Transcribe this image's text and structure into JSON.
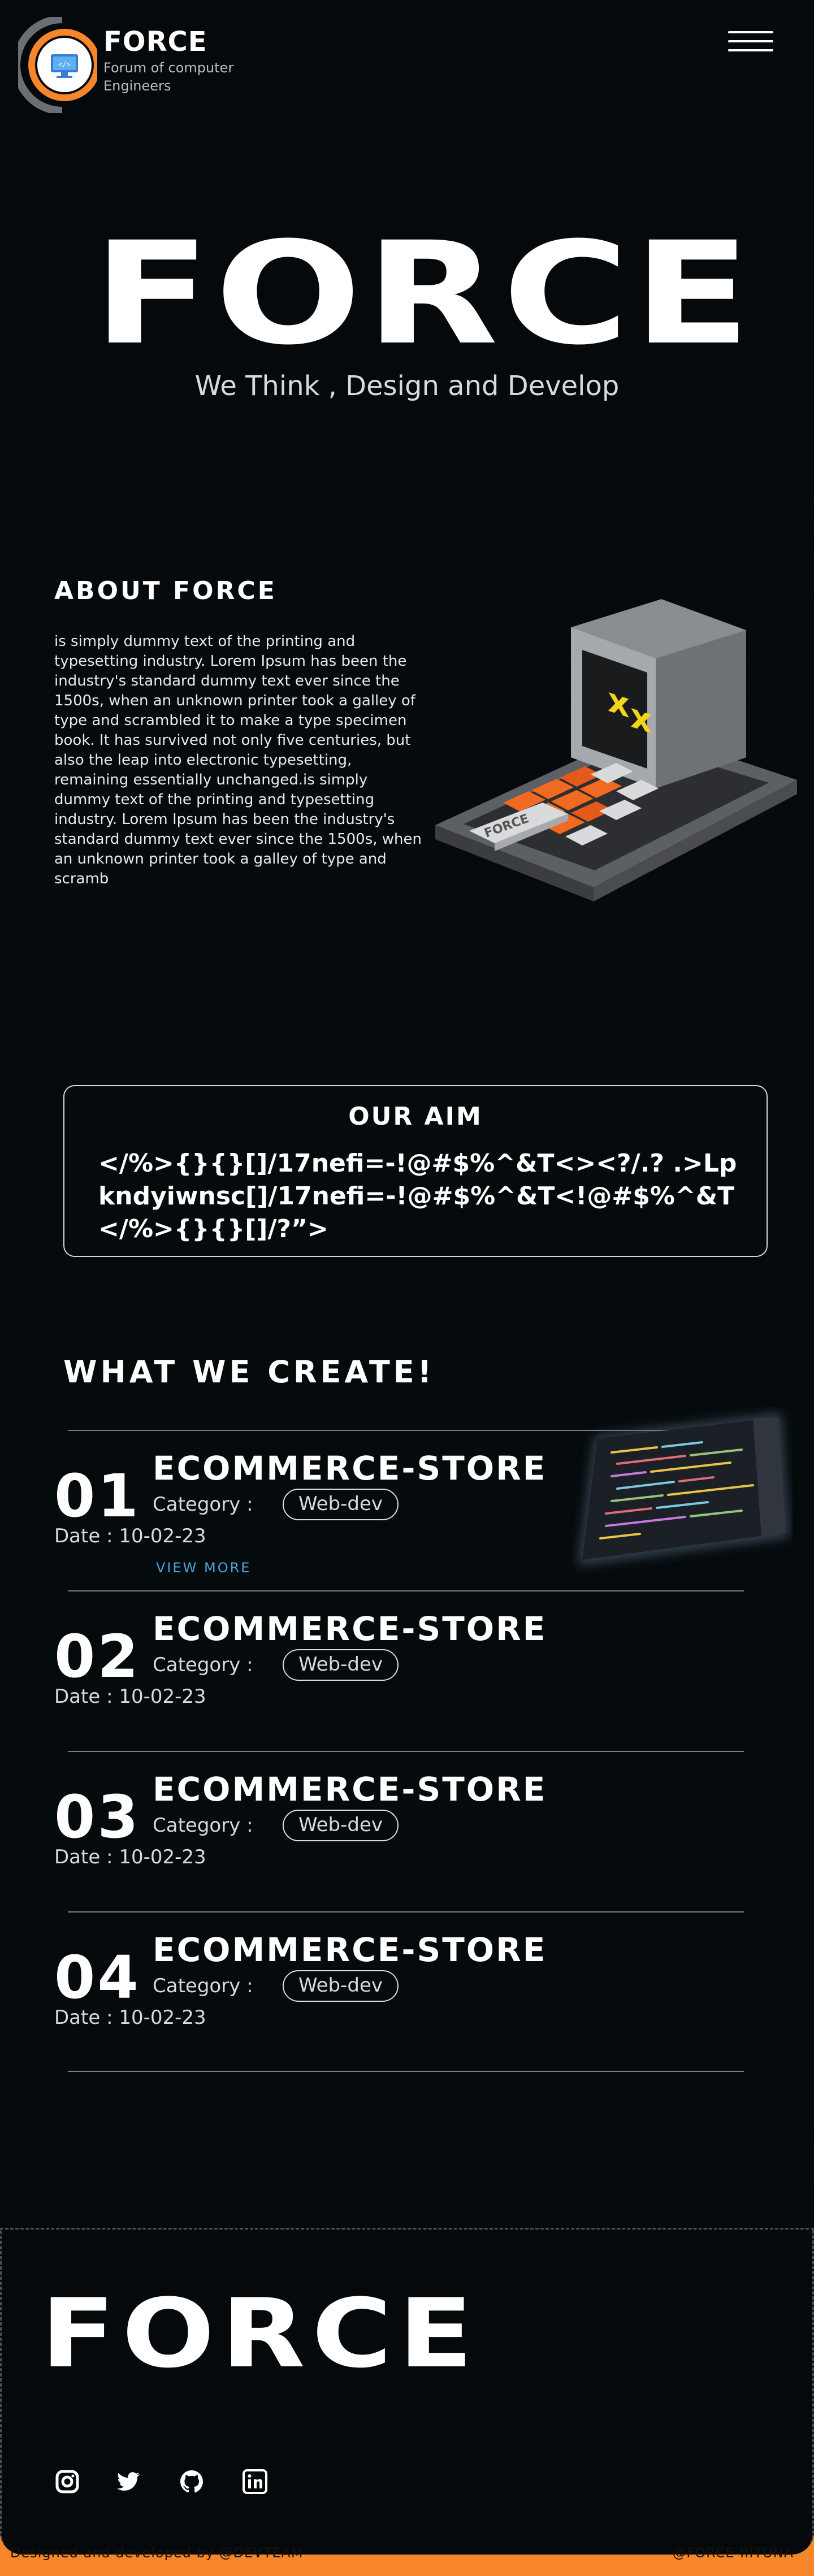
{
  "header": {
    "brand_name": "FORCE",
    "brand_subtitle": "Forum of computer Engineers",
    "logo_icon": "monitor-code-icon",
    "menu_icon": "hamburger-menu-icon"
  },
  "hero": {
    "title": "FORCE",
    "tagline": "We Think , Design and Develop"
  },
  "about": {
    "heading": "ABOUT FORCE",
    "text": "is simply dummy text of the printing and typesetting industry. Lorem Ipsum has been the industry's standard dummy text ever since the 1500s, when an unknown printer took a galley of type and scrambled it to make a type specimen book. It has survived not only five centuries, but also the leap into electronic typesetting, remaining essentially unchanged.is simply dummy text of the printing and typesetting industry. Lorem Ipsum has been the industry's standard dummy text ever since the 1500s, when an unknown printer took a galley of type and scramb",
    "illustration_label": "FORCE"
  },
  "aim": {
    "heading": "OUR AIM",
    "text": "</%>{}{}[]/17nefi=-!@#$%^&T<><?/.? .>Lpkndyiwnsc[]/17nefi=-!@#$%^&T<!@#$%^&T</%>{}{}[]/?”>"
  },
  "create": {
    "heading": "WHAT WE CREATE!",
    "projects": [
      {
        "number": "01",
        "title": "ECOMMERCE-STORE",
        "category_label": "Category :",
        "category": "Web-dev",
        "date": "Date : 10-02-23",
        "more": "VIEW MORE"
      },
      {
        "number": "02",
        "title": "ECOMMERCE-STORE",
        "category_label": "Category :",
        "category": "Web-dev",
        "date": "Date : 10-02-23"
      },
      {
        "number": "03",
        "title": "ECOMMERCE-STORE",
        "category_label": "Category :",
        "category": "Web-dev",
        "date": "Date : 10-02-23"
      },
      {
        "number": "04",
        "title": "ECOMMERCE-STORE",
        "category_label": "Category :",
        "category": "Web-dev",
        "date": "Date : 10-02-23"
      }
    ]
  },
  "footer": {
    "title": "FORCE",
    "socials": [
      "instagram-icon",
      "twitter-icon",
      "github-icon",
      "linkedin-icon"
    ],
    "credit_left": "Designed and developed by @DEVTEAM",
    "credit_right": "@FORCE-IIITUNA"
  },
  "colors": {
    "background": "#05090c",
    "accent": "#f7862a",
    "link": "#4aa3e0",
    "text": "#ffffff"
  }
}
